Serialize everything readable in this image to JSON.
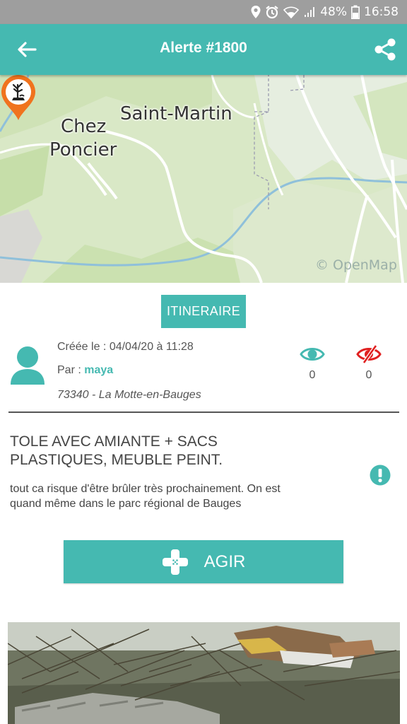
{
  "status_bar": {
    "battery": "48%",
    "time": "16:58"
  },
  "header": {
    "title": "Alerte #1800"
  },
  "map": {
    "labels": {
      "place_1": "Saint-Martin",
      "place_2_line1": "Chez",
      "place_2_line2": "Poncier"
    },
    "attribution": "© OpenMap"
  },
  "itinerary_button": "ITINERAIRE",
  "meta": {
    "created": "Créée le : 04/04/20 à 11:28",
    "by_prefix": "Par : ",
    "by_name": "maya",
    "location": "73340 - La Motte-en-Bauges"
  },
  "stats": {
    "views": "0",
    "hidden": "0"
  },
  "alert": {
    "title": "TOLE AVEC AMIANTE + SACS PLASTIQUES, MEUBLE PEINT.",
    "description": "tout ca risque d'être brûler très prochainement. On est quand même dans le parc régional de Bauges"
  },
  "action_button": "AGIR",
  "colors": {
    "accent": "#45b9b1",
    "marker": "#f0731e",
    "danger": "#e02020"
  }
}
